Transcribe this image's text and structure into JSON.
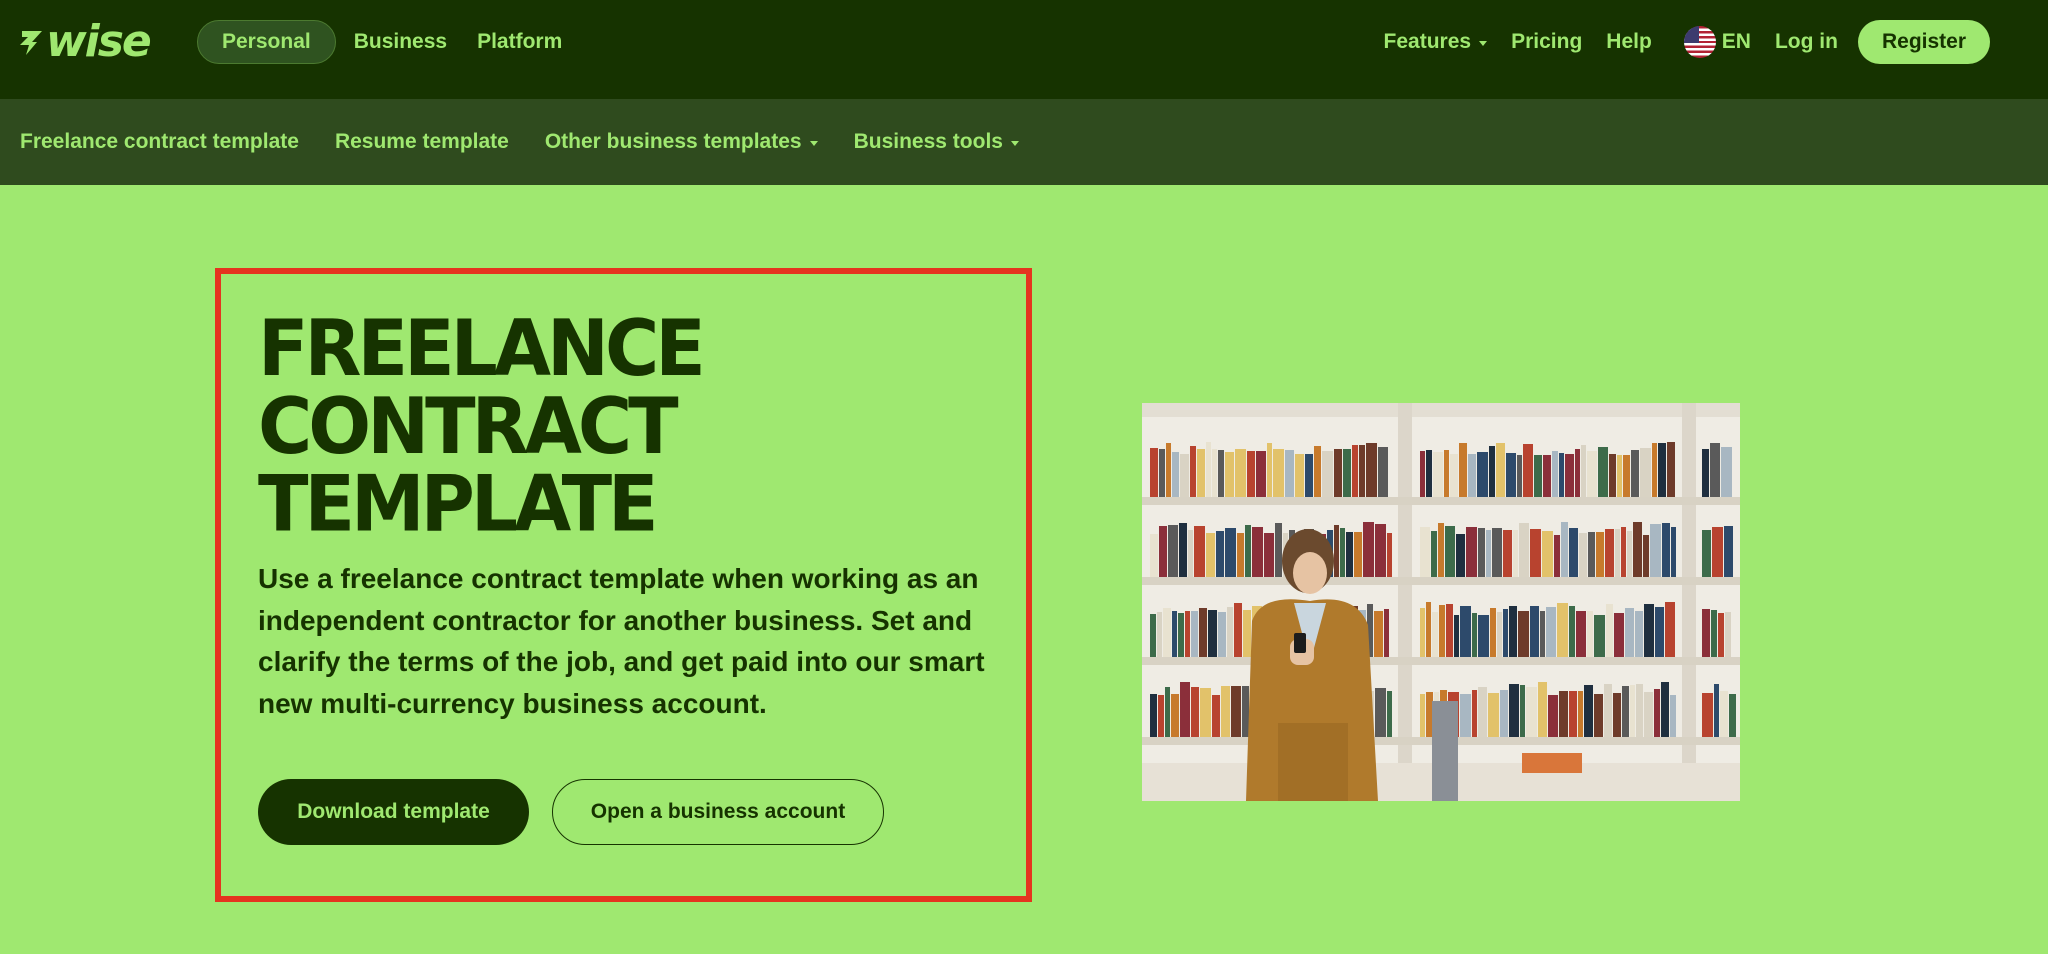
{
  "brand": {
    "logo_text": "wise",
    "accent": "#9fe870",
    "dark": "#163300",
    "subnav_bg": "#2f4b1e",
    "highlight": "#e5331f"
  },
  "topnav": {
    "segments": [
      {
        "label": "Personal",
        "active": true
      },
      {
        "label": "Business",
        "active": false
      },
      {
        "label": "Platform",
        "active": false
      }
    ],
    "features_label": "Features",
    "pricing_label": "Pricing",
    "help_label": "Help",
    "language_label": "EN",
    "language_icon": "us-flag-icon",
    "login_label": "Log in",
    "register_label": "Register"
  },
  "subnav": {
    "items": [
      {
        "label": "Freelance contract template",
        "has_dropdown": false
      },
      {
        "label": "Resume template",
        "has_dropdown": false
      },
      {
        "label": "Other business templates",
        "has_dropdown": true
      },
      {
        "label": "Business tools",
        "has_dropdown": true
      }
    ]
  },
  "hero": {
    "title_lines": [
      "FREELANCE",
      "CONTRACT",
      "TEMPLATE"
    ],
    "description": "Use a freelance contract template when working as an independent contractor for another business. Set and clarify the terms of the job, and get paid into our smart new multi-currency business account.",
    "primary_button": "Download template",
    "secondary_button": "Open a business account",
    "image_subject": "person-with-phone-in-front-of-bookshelves"
  }
}
